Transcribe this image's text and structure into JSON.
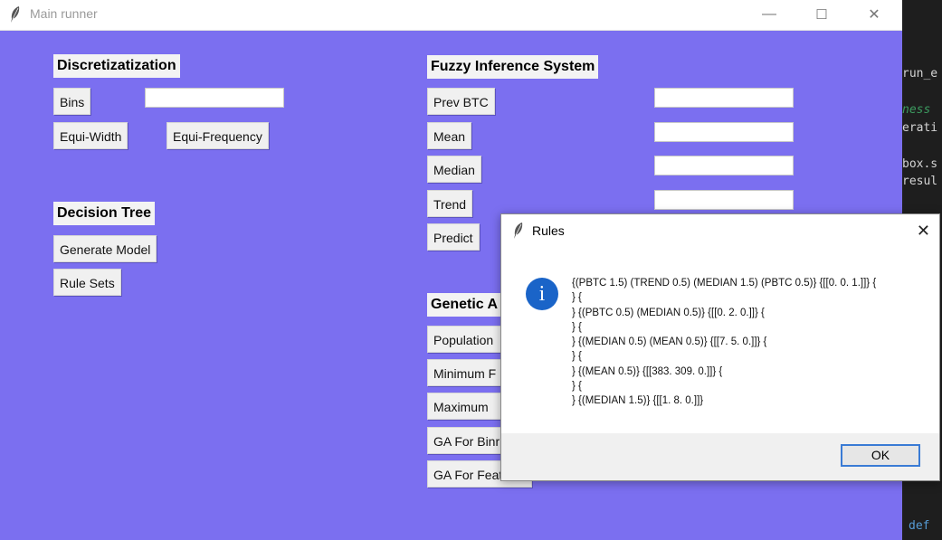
{
  "main_window": {
    "title": "Main runner",
    "controls": {
      "minimize": "—",
      "maximize": "☐",
      "close": "✕"
    }
  },
  "discretization": {
    "heading": "Discretizatization",
    "bins_label": "Bins",
    "equi_width_label": "Equi-Width",
    "equi_frequency_label": "Equi-Frequency"
  },
  "decision_tree": {
    "heading": "Decision Tree",
    "generate_model_label": "Generate Model",
    "rule_sets_label": "Rule Sets"
  },
  "fuzzy": {
    "heading": "Fuzzy Inference System",
    "prev_btc_label": "Prev BTC",
    "mean_label": "Mean",
    "median_label": "Median",
    "trend_label": "Trend",
    "predict_label": "Predict"
  },
  "genetic": {
    "heading": "Genetic A",
    "population_label": "Population",
    "minimum_label": "Minimum F",
    "maximum_label": "Maximum",
    "ga_bins_label": "GA For Binr",
    "ga_features_label": "GA For Feat"
  },
  "code_editor": {
    "lines": [
      "run_e",
      "ness",
      "erati",
      "box.s",
      "resul",
      "def"
    ]
  },
  "rules_dialog": {
    "title": "Rules",
    "close": "✕",
    "info_glyph": "i",
    "message_lines": [
      "{(PBTC 1.5) (TREND 0.5) (MEDIAN 1.5) (PBTC 0.5)} {[[0. 0. 1.]]} {",
      "} {",
      "} {(PBTC 0.5) (MEDIAN 0.5)} {[[0. 2. 0.]]} {",
      "} {",
      "} {(MEDIAN 0.5) (MEAN 0.5)} {[[7. 5. 0.]]} {",
      "} {",
      "} {(MEAN 0.5)} {[[383. 309.   0.]]} {",
      "} {",
      "} {(MEDIAN 1.5)} {[[1. 8. 0.]]}"
    ],
    "ok_label": "OK"
  },
  "colors": {
    "window_bg": "#7b6ff0",
    "dialog_accent": "#3a7bd5",
    "info_icon": "#1a64c8",
    "editor_bg": "#1e1e1e"
  }
}
